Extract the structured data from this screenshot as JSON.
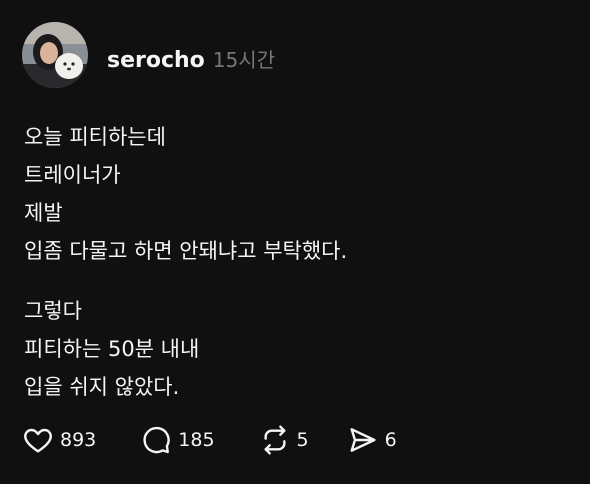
{
  "post": {
    "username": "serocho",
    "time": "15시간",
    "paragraphs": [
      [
        "오늘 피티하는데",
        "트레이너가",
        "제발",
        "입좀 다물고 하면 안돼냐고 부탁했다."
      ],
      [
        "그렇다",
        "피티하는 50분 내내",
        "입을 쉬지 않았다."
      ]
    ]
  },
  "actions": {
    "likes": "893",
    "comments": "185",
    "reposts": "5",
    "shares": "6"
  },
  "icons": {
    "like": "heart-icon",
    "comment": "speech-bubble-icon",
    "repost": "repost-arrows-icon",
    "share": "send-paper-plane-icon"
  },
  "colors": {
    "background": "#101010",
    "text": "#f3f5f7",
    "muted": "#777777"
  }
}
